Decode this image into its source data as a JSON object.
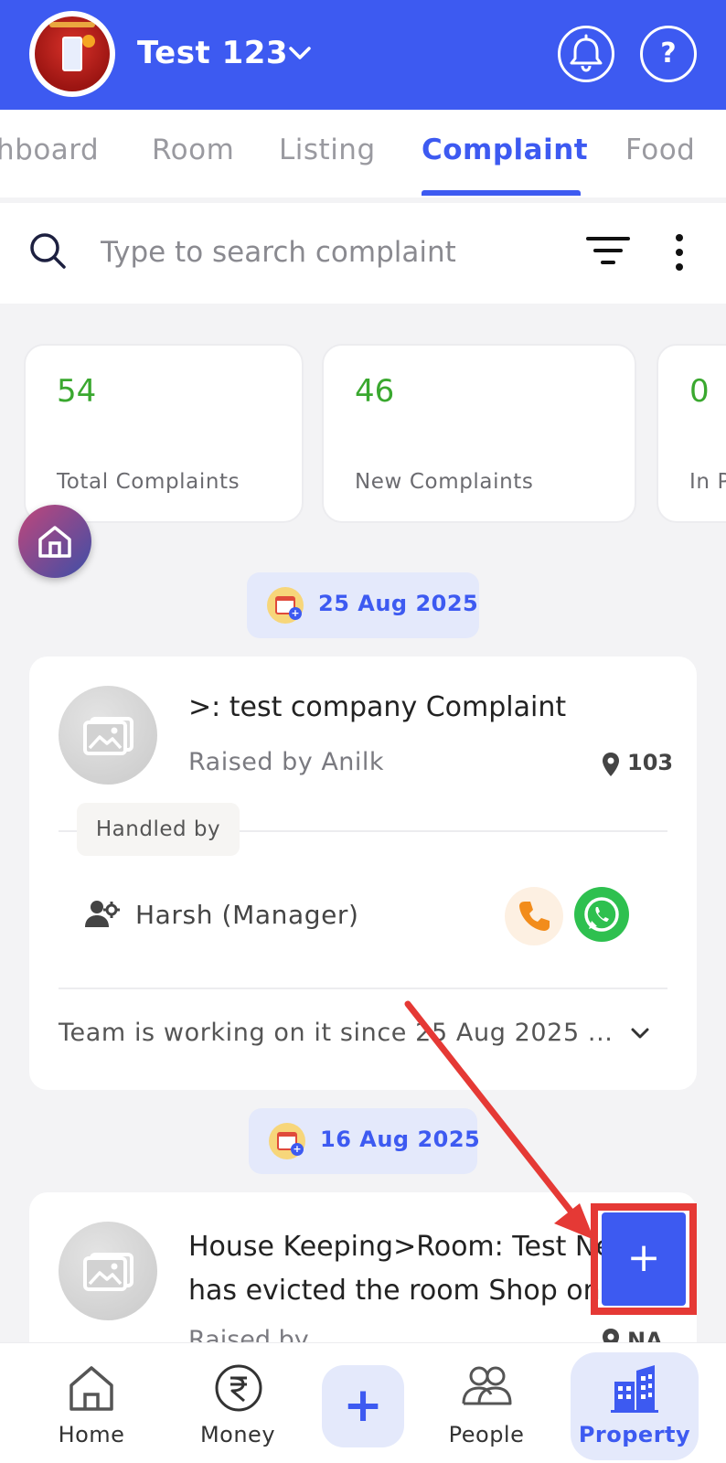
{
  "header": {
    "title": "Test 123",
    "help_glyph": "?",
    "icons": {
      "chevron": "chevron-down-icon",
      "bell": "bell-icon",
      "help": "help-icon"
    }
  },
  "tabs": [
    {
      "label": "hboard",
      "active": false
    },
    {
      "label": "Room",
      "active": false
    },
    {
      "label": "Listing",
      "active": false
    },
    {
      "label": "Complaint",
      "active": true
    },
    {
      "label": "Food",
      "active": false
    }
  ],
  "search": {
    "placeholder": "Type to search complaint",
    "value": ""
  },
  "stats": [
    {
      "value": "54",
      "label": "Total Complaints"
    },
    {
      "value": "46",
      "label": "New Complaints"
    },
    {
      "value": "0",
      "label": "In P"
    }
  ],
  "groups": [
    {
      "date": "25 Aug 2025",
      "complaint": {
        "title": ">: test company Complaint",
        "raised_by": "Raised by Anilk",
        "room": "103",
        "handled_label": "Handled by",
        "handler": "Harsh  (Manager)",
        "status": "Team is working on it since 25 Aug 2025 ..."
      }
    },
    {
      "date": "16 Aug 2025",
      "complaint": {
        "title_line1": "House Keeping>Room: Test Ne",
        "title_line2": "has evicted the room Shop on",
        "raised_by": "Raised by",
        "room": "NA"
      }
    }
  ],
  "fab": {
    "label": "+"
  },
  "bottom_nav": [
    {
      "label": "Home",
      "icon": "home-icon"
    },
    {
      "label": "Money",
      "icon": "rupee-icon"
    },
    {
      "label": "+",
      "icon": "plus-icon"
    },
    {
      "label": "People",
      "icon": "people-icon"
    },
    {
      "label": "Property",
      "icon": "building-icon",
      "active": true
    }
  ],
  "colors": {
    "primary": "#3d5af1",
    "stat_value": "#3aa82f",
    "annotation": "#e53935",
    "call": "#f28c1b",
    "whatsapp": "#2ec04f"
  }
}
